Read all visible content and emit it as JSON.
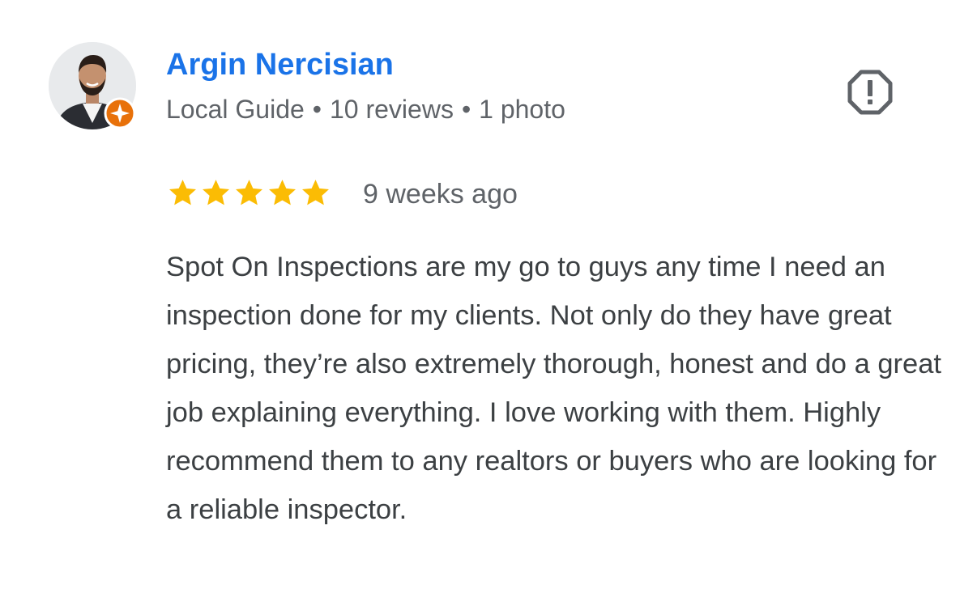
{
  "reviewer": {
    "name": "Argin Nercisian",
    "status": "Local Guide",
    "separator": "•",
    "reviews_count": "10 reviews",
    "photos_count": "1 photo",
    "badge_color": "#e8710a"
  },
  "rating": {
    "stars": 5,
    "max_stars": 5,
    "star_color": "#fbbc04"
  },
  "review": {
    "date": "9 weeks ago",
    "text": "Spot On Inspections are my go to guys any time I need an inspection done for my clients. Not only do they have great pricing, they’re also extremely thorough, honest and do a great job explaining everything. I love working with them. Highly recommend them to any realtors or buyers who are looking for a reliable inspector."
  },
  "icons": {
    "avatar": "avatar-photo",
    "badge": "local-guide-badge-icon",
    "report": "report-flag-icon",
    "star": "star-icon"
  },
  "colors": {
    "name_link": "#1a73e8",
    "secondary_text": "#5f6368",
    "body_text": "#3c4043",
    "report_icon": "#5f6368"
  }
}
